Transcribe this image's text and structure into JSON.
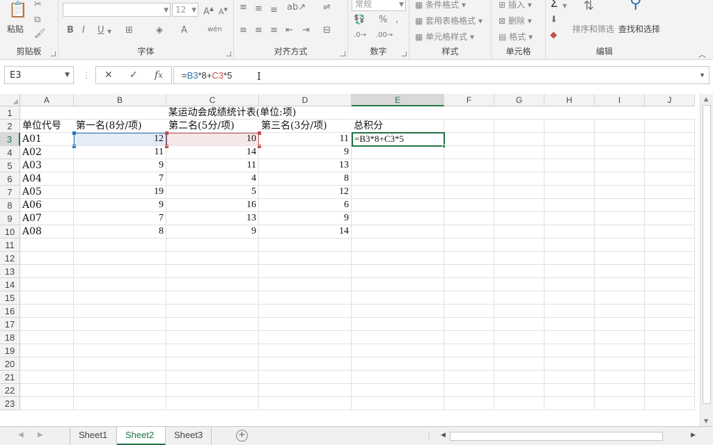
{
  "ribbon": {
    "groups": {
      "clipboard": {
        "label": "剪贴板",
        "paste_label": "粘贴"
      },
      "font": {
        "label": "字体",
        "font_size": "12"
      },
      "alignment": {
        "label": "对齐方式"
      },
      "number": {
        "label": "数字",
        "format": "常规"
      },
      "styles": {
        "label": "样式",
        "conditional": "条件格式",
        "table": "套用表格格式",
        "cell_styles": "单元格样式"
      },
      "cells": {
        "label": "单元格",
        "insert": "插入",
        "delete": "删除",
        "format": "格式"
      },
      "editing": {
        "label": "编辑",
        "sort_filter": "排序和筛选",
        "find_select": "查找和选择"
      }
    }
  },
  "formula_bar": {
    "name_box": "E3",
    "formula_parts": {
      "eq": "=",
      "b3": "B3",
      "op1": "*8+",
      "c3": "C3",
      "op2": "*5"
    }
  },
  "columns": [
    "A",
    "B",
    "C",
    "D",
    "E",
    "F",
    "G",
    "H",
    "I",
    "J"
  ],
  "rows": [
    "1",
    "2",
    "3",
    "4",
    "5",
    "6",
    "7",
    "8",
    "9",
    "10",
    "11",
    "12",
    "13",
    "14",
    "15",
    "16",
    "17",
    "18",
    "19",
    "20",
    "21",
    "22",
    "23"
  ],
  "sheet": {
    "title": "某运动会成绩统计表(单位:项)",
    "headers": [
      "单位代号",
      "第一名(8分/项)",
      "第二名(5分/项)",
      "第三名(3分/项)",
      "总积分"
    ],
    "data": [
      [
        "A01",
        "12",
        "10",
        "11"
      ],
      [
        "A02",
        "11",
        "14",
        "9"
      ],
      [
        "A03",
        "9",
        "11",
        "13"
      ],
      [
        "A04",
        "7",
        "4",
        "8"
      ],
      [
        "A05",
        "19",
        "5",
        "12"
      ],
      [
        "A06",
        "9",
        "16",
        "6"
      ],
      [
        "A07",
        "7",
        "13",
        "9"
      ],
      [
        "A08",
        "8",
        "9",
        "14"
      ]
    ],
    "active_cell_text": "=B3*8+C3*5"
  },
  "tabs": [
    "Sheet1",
    "Sheet2",
    "Sheet3"
  ],
  "active_tab": "Sheet2",
  "colors": {
    "accent": "#217346",
    "ref_b": "#2e75b6",
    "ref_c": "#c0504d"
  }
}
